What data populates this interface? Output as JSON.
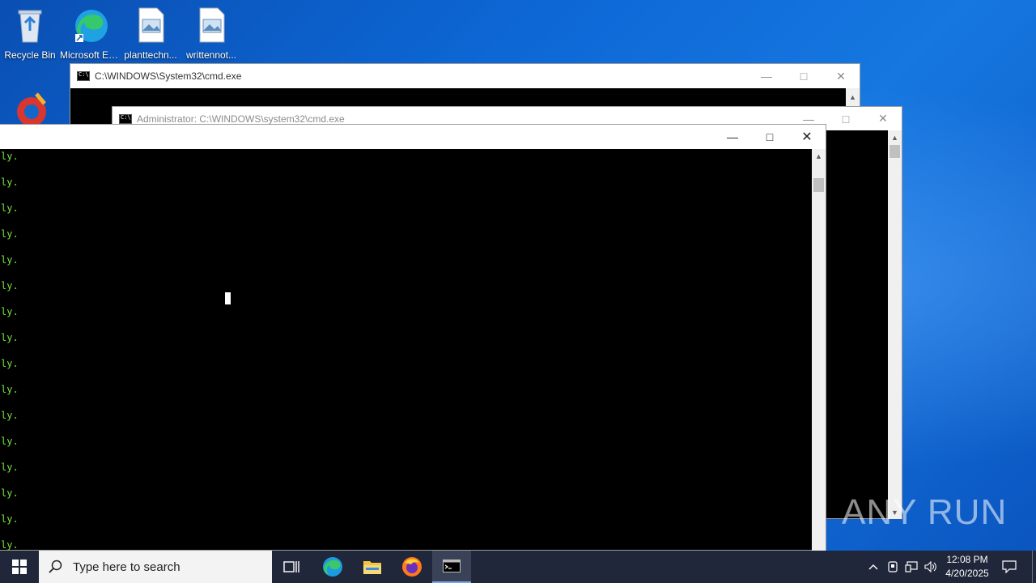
{
  "desktop": {
    "icons": [
      {
        "label": "Recycle Bin",
        "icon": "recycle-bin-icon"
      },
      {
        "label": "Microsoft Edge",
        "icon": "edge-icon"
      },
      {
        "label": "planttechn...",
        "icon": "image-file-icon"
      },
      {
        "label": "writtennot...",
        "icon": "image-file-icon"
      },
      {
        "label": "",
        "icon": "ccleaner-icon"
      }
    ]
  },
  "windows": {
    "back": {
      "title": "C:\\WINDOWS\\System32\\cmd.exe"
    },
    "middle": {
      "title": "Administrator: C:\\WINDOWS\\system32\\cmd.exe"
    },
    "front": {
      "title": "",
      "lines": [
        "ly.",
        "ly.",
        "ly.",
        "ly.",
        "ly.",
        "ly.",
        "ly.",
        "ly.",
        "ly.",
        "ly.",
        "ly.",
        "ly.",
        "ly.",
        "ly.",
        "ly.",
        "ly."
      ],
      "text_color": "#78e23c"
    }
  },
  "taskbar": {
    "search_placeholder": "Type here to search",
    "apps": [
      "task-view-icon",
      "edge-icon",
      "file-explorer-icon",
      "firefox-icon",
      "cmd-icon"
    ],
    "time": "12:08 PM",
    "date": "4/20/2025"
  },
  "watermark": "ANY RUN",
  "colors": {
    "desktop": "#0d68d6",
    "taskbar": "#20273a",
    "console_text": "#78e23c"
  }
}
